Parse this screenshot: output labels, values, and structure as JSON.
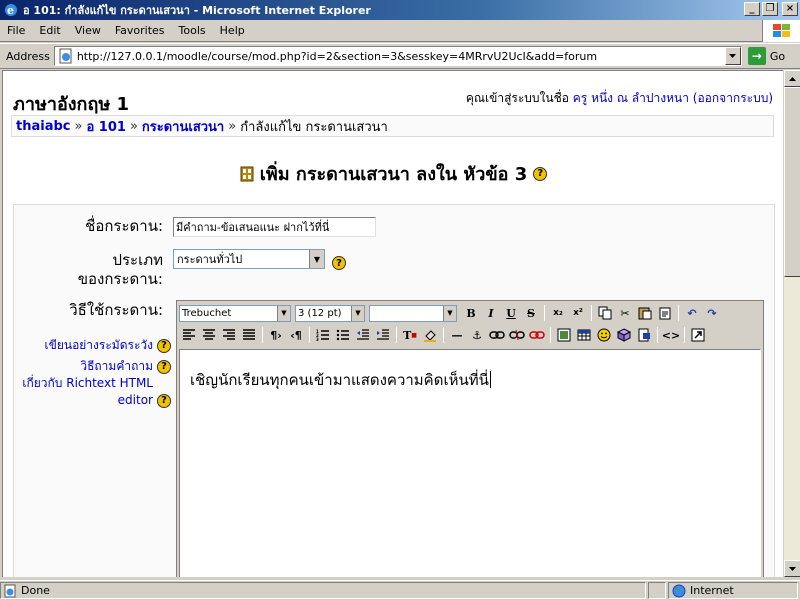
{
  "window": {
    "title": "อ 101: กำลังแก้ไข กระดานเสวนา - Microsoft Internet Explorer",
    "buttons": {
      "minimize": "_",
      "maximize": "❐",
      "close": "×"
    }
  },
  "menu": [
    "File",
    "Edit",
    "View",
    "Favorites",
    "Tools",
    "Help"
  ],
  "address": {
    "label": "Address",
    "url": "http://127.0.0.1/moodle/course/mod.php?id=2&section=3&sesskey=4MRrvU2UcI&add=forum",
    "go_label": "Go"
  },
  "header": {
    "course_title": "ภาษาอังกฤษ 1",
    "login_prefix": "คุณเข้าสู่ระบบในชื่อ",
    "user_name": "ครู หนึ่ง ณ ลำปางหนา",
    "logout_label": "(ออกจากระบบ)"
  },
  "breadcrumb": {
    "items": [
      "thaiabc",
      "อ 101",
      "กระดานเสวนา"
    ],
    "separator": "»",
    "current": "กำลังแก้ไข กระดานเสวนา"
  },
  "heading": {
    "text": "เพิ่ม กระดานเสวนา ลงใน หัวข้อ 3"
  },
  "form": {
    "forum_name_label": "ชื่อกระดาน:",
    "forum_name_value": "มีคำถาม-ข้อเสนอแนะ ฝากไว้ที่นี่",
    "forum_type_label_1": "ประเภท",
    "forum_type_label_2": "ของกระดาน:",
    "forum_type_value": "กระดานทั่วไป",
    "intro_label": "วิธีใช้กระดาน:"
  },
  "side_links": {
    "write_carefully": "เขียนอย่างระมัดระวัง",
    "ask_questions": "วิธีถามคำถาม",
    "about_richtext_1": "เกี่ยวกับ Richtext HTML",
    "about_richtext_2": "editor"
  },
  "editor": {
    "font_family": "Trebuchet",
    "font_size": "3 (12 pt)",
    "paragraph": "",
    "content": "เชิญนักเรียนทุกคนเข้ามาแสดงความคิดเห็นที่นี่"
  },
  "help_glyph": "?",
  "status": {
    "left": "Done",
    "zone": "Internet"
  }
}
